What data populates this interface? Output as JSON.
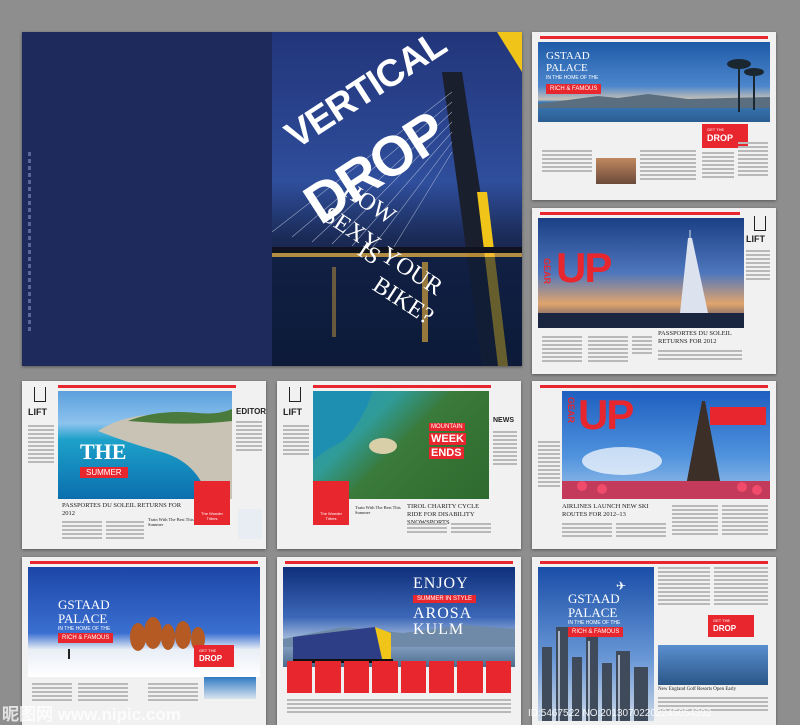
{
  "cover": {
    "title1": "VERTICAL",
    "title2": "DROP",
    "title3": "HOW",
    "title4": "SEXY",
    "title5": "IS",
    "title6": "YOUR",
    "title7": "BIKE?"
  },
  "gstaad1": {
    "title1": "GSTAAD",
    "title2": "PALACE",
    "subtitle": "IN THE HOME OF THE",
    "badge": "RICH & FAMOUS",
    "tag": "GET THE",
    "tag2": "DROP"
  },
  "gearup1": {
    "gear": "GEAR",
    "up": "UP",
    "lift": "LIFT",
    "headline": "PASSPORTES DU SOLEIL RETURNS FOR 2012"
  },
  "summer": {
    "lift": "LIFT",
    "editor": "EDITOR",
    "the": "THE",
    "summer": "SUMMER",
    "headline": "PASSPORTES DU SOLEIL RETURNS FOR 2012",
    "sub": "Train With The Best This Summer",
    "card": "The Wonder Tribes"
  },
  "mountain": {
    "lift": "LIFT",
    "news": "NEWS",
    "l1": "MOUNTAIN",
    "l2": "WEEK",
    "l3": "ENDS",
    "card": "The Wonder Tribes",
    "sub": "Train With The Best This Summer",
    "headline": "TIROL CHARITY CYCLE RIDE FOR DISABILITY SNOWSPORTS"
  },
  "gearup2": {
    "gear": "GEAR",
    "up": "UP",
    "headline": "AIRLINES LAUNCH NEW SKI ROUTES FOR 2012–13"
  },
  "gstaad2": {
    "title1": "GSTAAD",
    "title2": "PALACE",
    "subtitle": "IN THE HOME OF THE",
    "badge": "RICH & FAMOUS",
    "tag": "GET THE",
    "tag2": "DROP"
  },
  "enjoy": {
    "l1": "ENJOY",
    "l2": "SUMMER IN STYLE",
    "l3": "AROSA",
    "l4": "KULM"
  },
  "gstaad3": {
    "title1": "GSTAAD",
    "title2": "PALACE",
    "subtitle": "IN THE HOME OF THE",
    "badge": "RICH & FAMOUS",
    "tag": "GET THE",
    "tag2": "DROP",
    "headline": "New England Golf Resorts Open Early"
  },
  "watermark": {
    "left": "昵图网 www.nipic.com",
    "right": "ID:5467522 NO:20130702202245054392"
  },
  "colors": {
    "red": "#e8262e",
    "navy": "#1f2a5c",
    "sky": "#2b6fc4"
  }
}
